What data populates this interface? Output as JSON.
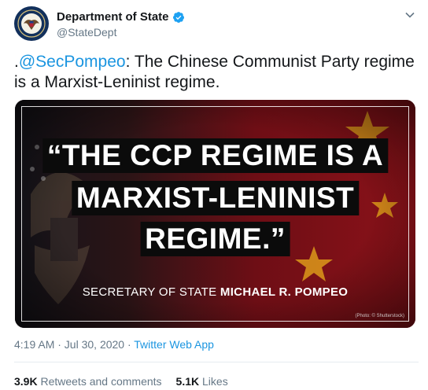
{
  "author": {
    "display_name": "Department of State",
    "handle": "@StateDept"
  },
  "tweet": {
    "text_prefix": ".",
    "mention": "@SecPompeo",
    "text_rest": ": The Chinese Communist Party regime is a Marxist-Leninist regime."
  },
  "media": {
    "quote_lines": [
      "“THE CCP REGIME IS A",
      "MARXIST-LENINIST",
      "REGIME.”"
    ],
    "attribution_title": "SECRETARY OF STATE ",
    "attribution_name": "MICHAEL R. POMPEO",
    "photo_credit": "(Photo: © Shutterstock)"
  },
  "meta": {
    "timestamp": "4:19 AM · Jul 30, 2020 · ",
    "source_app": "Twitter Web App"
  },
  "stats": {
    "retweets_count": "3.9K",
    "retweets_label": " Retweets and comments",
    "likes_count": "5.1K",
    "likes_label": " Likes"
  },
  "colors": {
    "link": "#1b95e0",
    "secondary_text": "#657786",
    "verified": "#1da1f2",
    "flag_red": "#a3121a",
    "star_gold": "#e3a21a"
  },
  "icons": [
    "state-department-seal-icon",
    "verified-badge-icon",
    "chevron-down-icon"
  ]
}
